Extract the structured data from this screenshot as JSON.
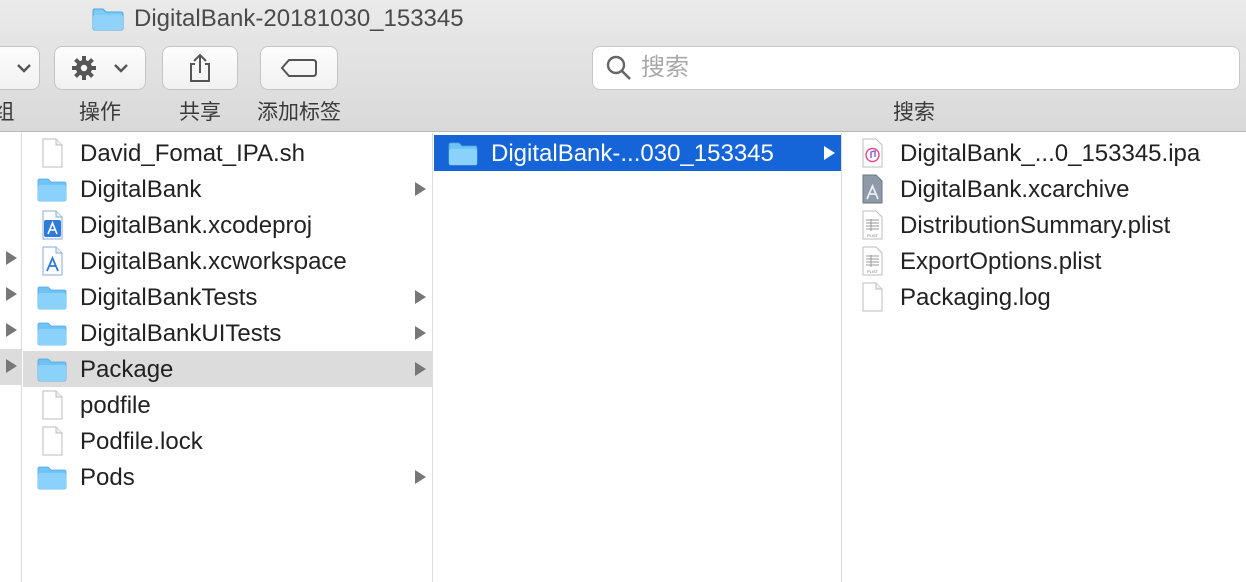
{
  "window": {
    "title": "DigitalBank-20181030_153345"
  },
  "toolbar": {
    "group_label_partial": "组",
    "action_label": "操作",
    "share_label": "共享",
    "tags_label": "添加标签",
    "search_label": "搜索",
    "search_placeholder": "搜索"
  },
  "column1": {
    "items": [
      {
        "name": "David_Fomat_IPA.sh",
        "icon": "document-icon",
        "has_children": false
      },
      {
        "name": "DigitalBank",
        "icon": "folder-icon",
        "has_children": true
      },
      {
        "name": "DigitalBank.xcodeproj",
        "icon": "xcode-project-icon",
        "has_children": false
      },
      {
        "name": "DigitalBank.xcworkspace",
        "icon": "xcode-workspace-icon",
        "has_children": false
      },
      {
        "name": "DigitalBankTests",
        "icon": "folder-icon",
        "has_children": true
      },
      {
        "name": "DigitalBankUITests",
        "icon": "folder-icon",
        "has_children": true
      },
      {
        "name": "Package",
        "icon": "folder-icon",
        "has_children": true,
        "highlighted": true
      },
      {
        "name": "podfile",
        "icon": "document-icon",
        "has_children": false
      },
      {
        "name": "Podfile.lock",
        "icon": "document-icon",
        "has_children": false
      },
      {
        "name": "Pods",
        "icon": "folder-icon",
        "has_children": true
      }
    ]
  },
  "column2": {
    "items": [
      {
        "name": "DigitalBank-...030_153345",
        "icon": "folder-icon",
        "has_children": true,
        "selected": true
      }
    ]
  },
  "column3": {
    "items": [
      {
        "name": "DigitalBank_...0_153345.ipa",
        "icon": "ipa-file-icon"
      },
      {
        "name": "DigitalBank.xcarchive",
        "icon": "xcarchive-icon"
      },
      {
        "name": "DistributionSummary.plist",
        "icon": "plist-file-icon"
      },
      {
        "name": "ExportOptions.plist",
        "icon": "plist-file-icon"
      },
      {
        "name": "Packaging.log",
        "icon": "document-icon"
      }
    ]
  },
  "colors": {
    "selection": "#1565d8",
    "highlight": "#dcdcdc",
    "folder": "#6cc3f5"
  }
}
